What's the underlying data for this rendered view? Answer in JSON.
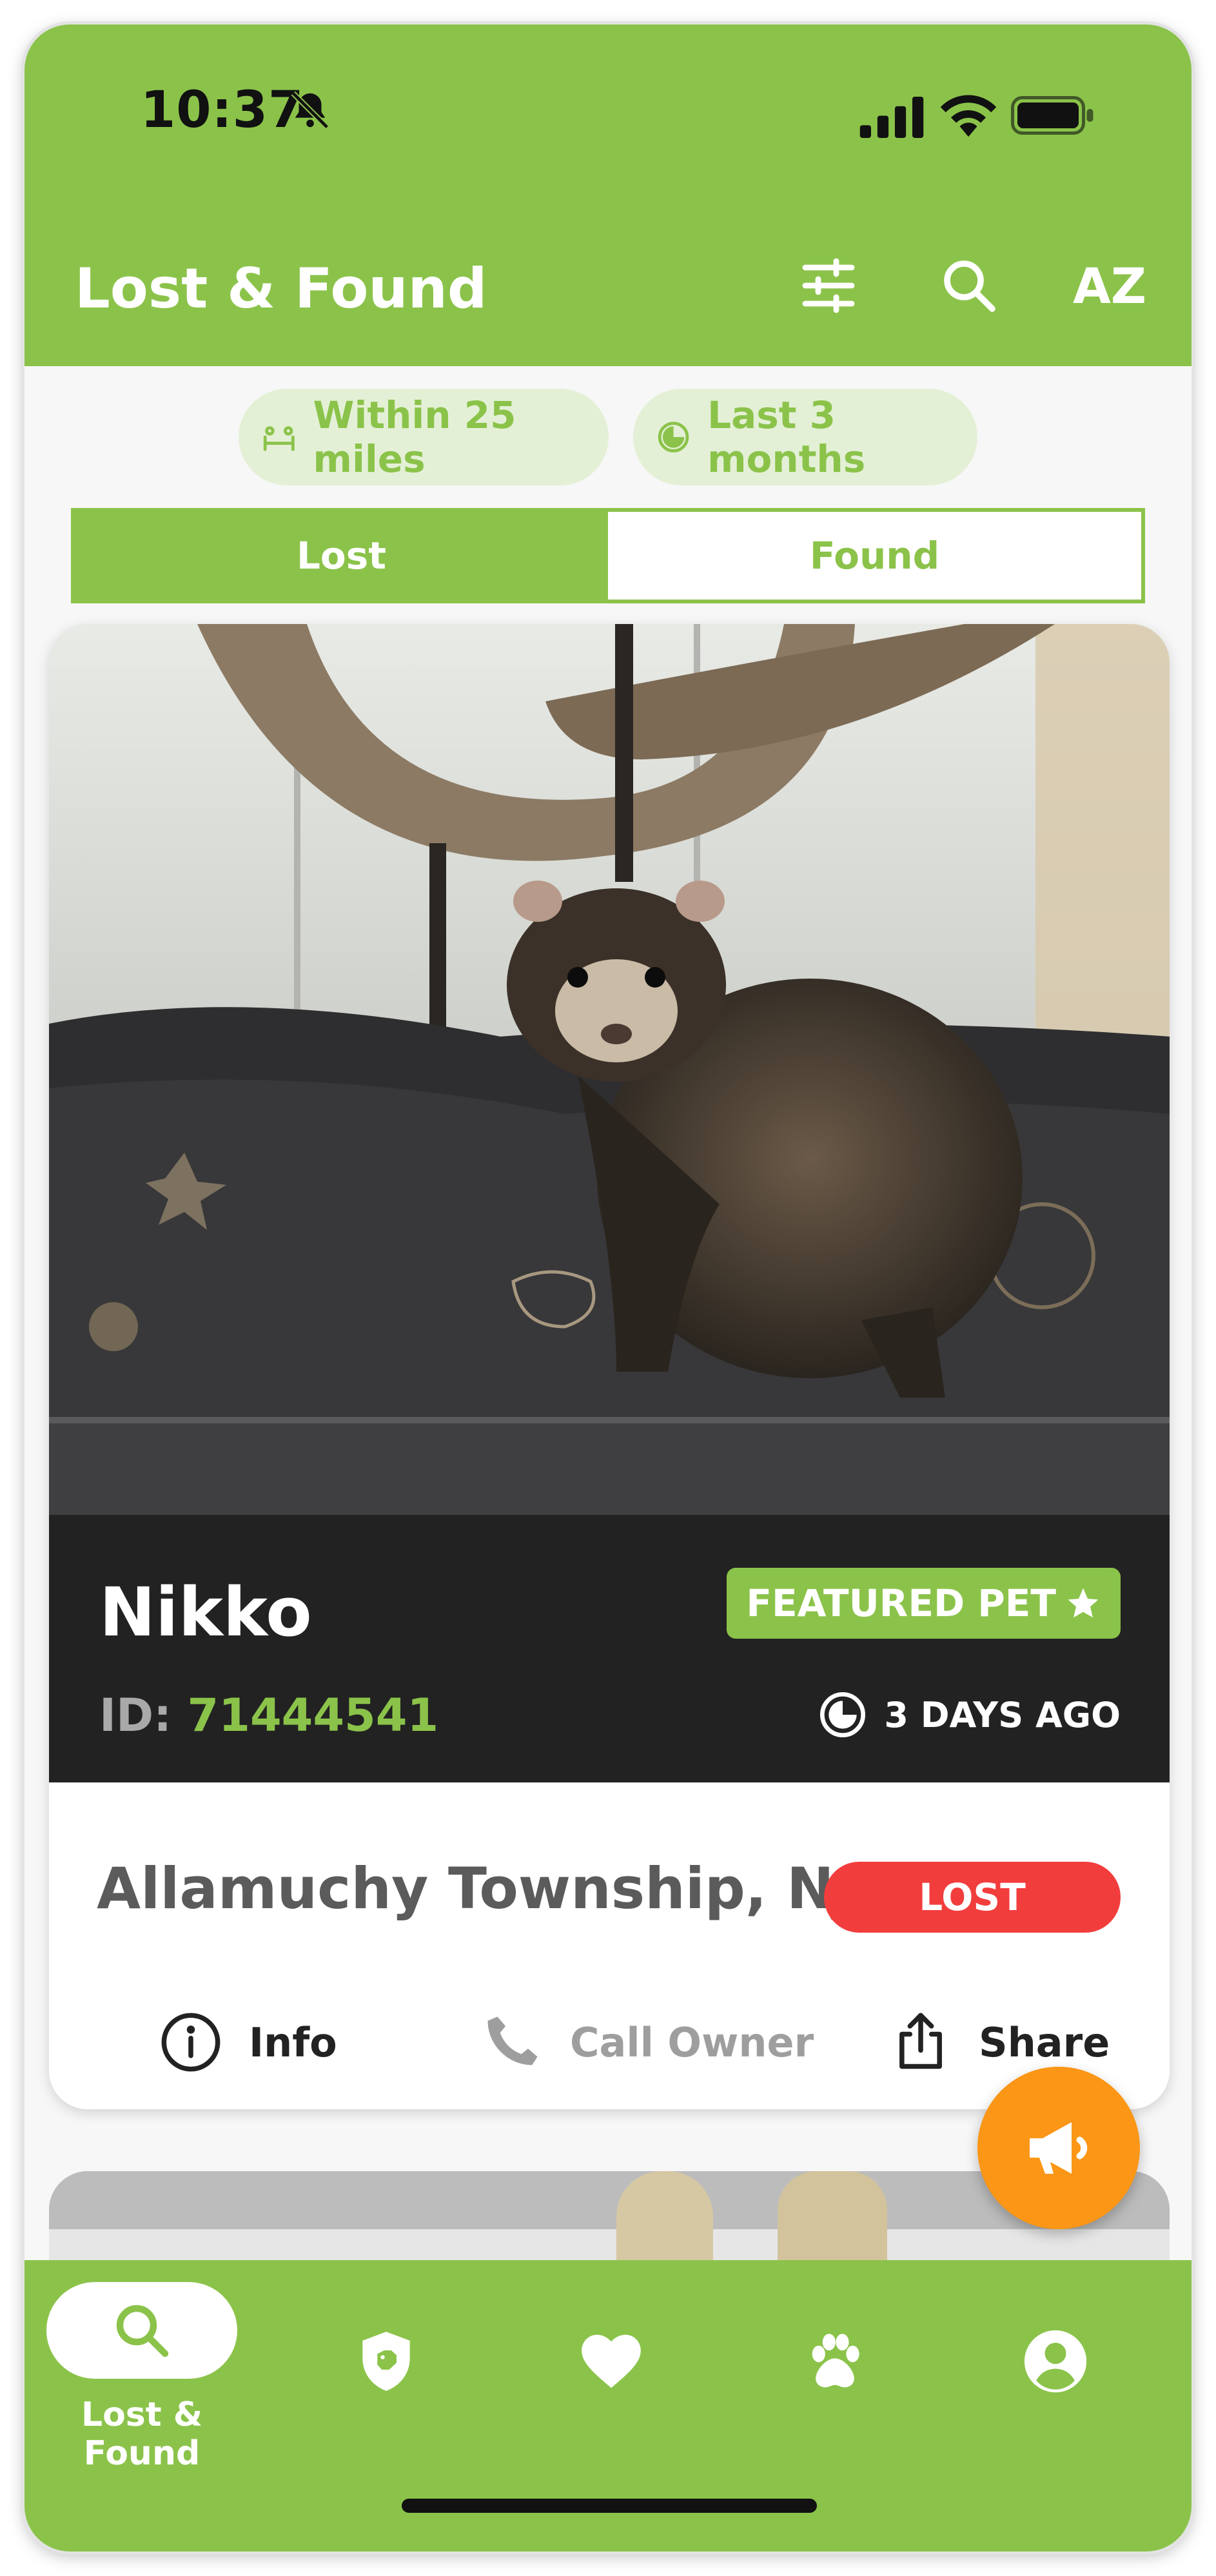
{
  "colors": {
    "accent": "#8bc34a",
    "orange": "#fb9616",
    "lost_red": "#f23d3d",
    "dark_band": "#222222"
  },
  "status_bar": {
    "time": "10:37",
    "icons": [
      "bell-muted-icon",
      "cellular-signal-icon",
      "wifi-icon",
      "battery-icon"
    ]
  },
  "header": {
    "title": "Lost & Found",
    "icons": [
      "filter-sliders-icon",
      "search-icon",
      "sort-az-icon"
    ],
    "sort_label": "AZ"
  },
  "chips": [
    {
      "label": "Within 25 miles",
      "icon": "distance-icon"
    },
    {
      "label": "Last 3 months",
      "icon": "clock-icon"
    }
  ],
  "segmented": {
    "lost": "Lost",
    "found": "Found",
    "selected": "Lost"
  },
  "card": {
    "pet_name": "Nikko",
    "featured_label": "FEATURED PET",
    "id_label": "ID:",
    "id_value": "71444541",
    "posted": "3 DAYS AGO",
    "location": "Allamuchy Township, NJ 07...",
    "status": "LOST",
    "actions": [
      {
        "label": "Info",
        "icon": "info-icon"
      },
      {
        "label": "Call Owner",
        "icon": "phone-icon"
      },
      {
        "label": "Share",
        "icon": "share-icon"
      }
    ]
  },
  "tabbar": {
    "items": [
      {
        "label": "Lost & Found",
        "icon": "search-icon",
        "active": true
      },
      {
        "icon": "shield-pet-icon"
      },
      {
        "icon": "heart-icon"
      },
      {
        "icon": "paw-icon"
      },
      {
        "icon": "profile-icon"
      }
    ]
  },
  "fab_icon": "megaphone-icon"
}
